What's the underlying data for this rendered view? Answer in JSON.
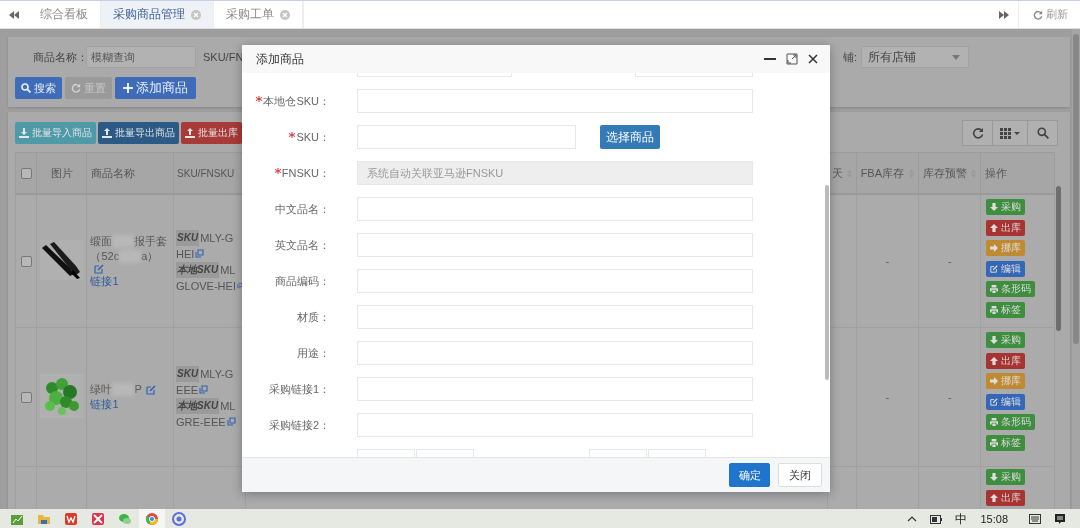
{
  "tabs": {
    "items": [
      {
        "label": "综合看板",
        "closable": false,
        "selected": false
      },
      {
        "label": "采购商品管理",
        "closable": true,
        "selected": true
      },
      {
        "label": "采购工单",
        "closable": true,
        "selected": false
      }
    ],
    "refresh": "刷新"
  },
  "search": {
    "name_label": "商品名称：",
    "name_placeholder": "模糊查询",
    "clipped_label": "SKU/FN",
    "shop_label": "铺:",
    "shop_select": "所有店铺",
    "buttons": [
      {
        "label": "搜索",
        "kind": "search",
        "disabled": false
      },
      {
        "label": "重置",
        "kind": "reset",
        "disabled": true
      },
      {
        "label": "添加商品",
        "kind": "add",
        "disabled": false
      }
    ]
  },
  "toolbar": {
    "buttons": [
      {
        "label": "批量导入商品",
        "kind": "import",
        "color": "#4f9aa8"
      },
      {
        "label": "批量导出商品",
        "kind": "export",
        "color": "#2c5a86"
      },
      {
        "label": "批量出库",
        "kind": "export",
        "color": "#a83a38"
      }
    ]
  },
  "table": {
    "header_checked": false,
    "columns_left": [
      "图片",
      "商品名称",
      "SKU/FNSKU"
    ],
    "columns_right": [
      {
        "label": "天",
        "sortable": true
      },
      {
        "label": "FBA库存",
        "sortable": true
      },
      {
        "label": "库存预警",
        "sortable": true
      },
      {
        "label": "操作",
        "sortable": false
      }
    ],
    "rows": [
      {
        "checked": false,
        "name_lines": [
          [
            "缎面",
            "报手套"
          ],
          [
            "（52c",
            "a）"
          ]
        ],
        "link": "链接1",
        "sku": {
          "badge": "SKU",
          "lines": [
            "MLY-G",
            "HEI"
          ]
        },
        "local_sku": {
          "badge": "本地SKU",
          "lines": [
            "ML",
            "GLOVE-HEI"
          ]
        },
        "fba_stock": "-",
        "stock_alert": "-",
        "actions": [
          {
            "label": "采购",
            "kind": "purchase",
            "color": "#3f8d3f"
          },
          {
            "label": "出库",
            "kind": "out",
            "color": "#a83432"
          },
          {
            "label": "挪库",
            "kind": "transfer",
            "color": "#c08a32"
          },
          {
            "label": "编辑",
            "kind": "edit",
            "color": "#3467b8"
          },
          {
            "label": "条形码",
            "kind": "print",
            "color": "#3f8d3f"
          },
          {
            "label": "标签",
            "kind": "print",
            "color": "#3f8d3f"
          }
        ]
      },
      {
        "checked": false,
        "name_lines": [
          [
            "绿叶",
            "P"
          ]
        ],
        "link": "链接1",
        "sku": {
          "badge": "SKU",
          "lines": [
            "MLY-G",
            "EEE"
          ]
        },
        "local_sku": {
          "badge": "本地SKU",
          "lines": [
            "ML",
            "GRE-EEE"
          ]
        },
        "fba_stock": "-",
        "stock_alert": "-",
        "actions": [
          {
            "label": "采购",
            "kind": "purchase",
            "color": "#3f8d3f"
          },
          {
            "label": "出库",
            "kind": "out",
            "color": "#a83432"
          },
          {
            "label": "挪库",
            "kind": "transfer",
            "color": "#c08a32"
          },
          {
            "label": "编辑",
            "kind": "edit",
            "color": "#3467b8"
          },
          {
            "label": "条形码",
            "kind": "print",
            "color": "#3f8d3f"
          },
          {
            "label": "标签",
            "kind": "print",
            "color": "#3f8d3f"
          }
        ]
      },
      {
        "actions": [
          {
            "label": "采购",
            "kind": "purchase",
            "color": "#3f8d3f"
          },
          {
            "label": "出库",
            "kind": "out",
            "color": "#a83432"
          }
        ]
      }
    ]
  },
  "dialog": {
    "title": "添加商品",
    "fields": [
      {
        "label": "本地仓SKU：",
        "required": true,
        "kind": "text"
      },
      {
        "label": "SKU：",
        "required": true,
        "kind": "picker",
        "button": "选择商品"
      },
      {
        "label": "FNSKU：",
        "required": true,
        "kind": "readonly",
        "placeholder": "系统自动关联亚马逊FNSKU"
      },
      {
        "label": "中文品名：",
        "required": false,
        "kind": "text"
      },
      {
        "label": "英文品名：",
        "required": false,
        "kind": "text"
      },
      {
        "label": "商品编码：",
        "required": false,
        "kind": "text"
      },
      {
        "label": "材质：",
        "required": false,
        "kind": "text"
      },
      {
        "label": "用途：",
        "required": false,
        "kind": "text"
      },
      {
        "label": "采购链接1：",
        "required": false,
        "kind": "text"
      },
      {
        "label": "采购链接2：",
        "required": false,
        "kind": "text"
      }
    ],
    "buttons": [
      {
        "label": "确定",
        "primary": true
      },
      {
        "label": "关闭",
        "primary": false
      }
    ]
  },
  "taskbar": {
    "ime": "中",
    "clock": "15:08"
  }
}
